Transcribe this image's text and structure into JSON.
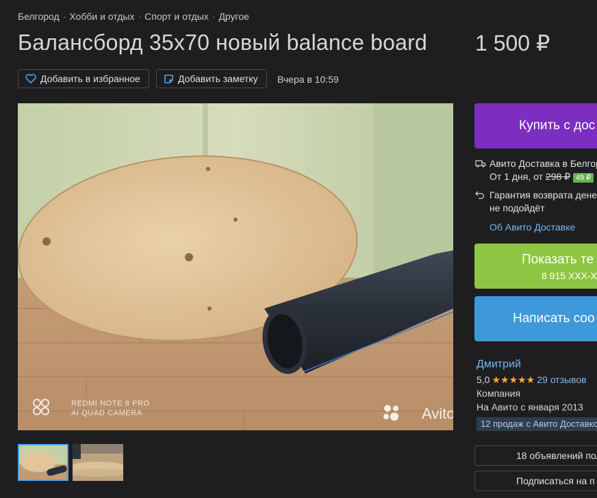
{
  "breadcrumb": [
    "Белгород",
    "Хобби и отдых",
    "Спорт и отдых",
    "Другое"
  ],
  "listing": {
    "title": "Балансборд 35х70 новый balance board",
    "price": "1 500 ₽",
    "posted": "Вчера в 10:59"
  },
  "actions": {
    "favorite_label": "Добавить в избранное",
    "note_label": "Добавить заметку"
  },
  "photo": {
    "watermark_device_line1": "REDMI NOTE 8 PRO",
    "watermark_device_line2": "AI QUAD CAMERA",
    "watermark_brand": "Avito"
  },
  "purchase": {
    "buy_label": "Купить с дос",
    "delivery_line1": "Авито Доставка в Белгор",
    "delivery_line2_prefix": "От 1 дня, от",
    "delivery_old_price": "298 ₽",
    "delivery_new_price": "49 ₽",
    "guarantee_line1": "Гарантия возврата дене",
    "guarantee_line2": "не подойдёт",
    "about_link": "Об Авито Доставке",
    "phone_label": "Показать те",
    "phone_number": "8 915 XXX-X",
    "message_label": "Написать соо"
  },
  "seller": {
    "name": "Дмитрий",
    "rating": "5,0",
    "stars": "★★★★★",
    "reviews": "29 отзывов",
    "type": "Компания",
    "since": "На Авито с января 2013",
    "sales_badge": "12 продаж с Авито Доставко",
    "ads_button": "18 объявлений пол",
    "subscribe_button": "Подписаться на п"
  },
  "colors": {
    "background": "#1e1e21",
    "buy": "#7b2ebf",
    "phone": "#8ec644",
    "message": "#3d99d9",
    "link": "#7ab8ec",
    "stars": "#ffb021"
  },
  "icons": [
    "heart-icon",
    "note-icon",
    "truck-icon",
    "return-icon",
    "avito-logo-icon",
    "camera-logo-icon"
  ]
}
